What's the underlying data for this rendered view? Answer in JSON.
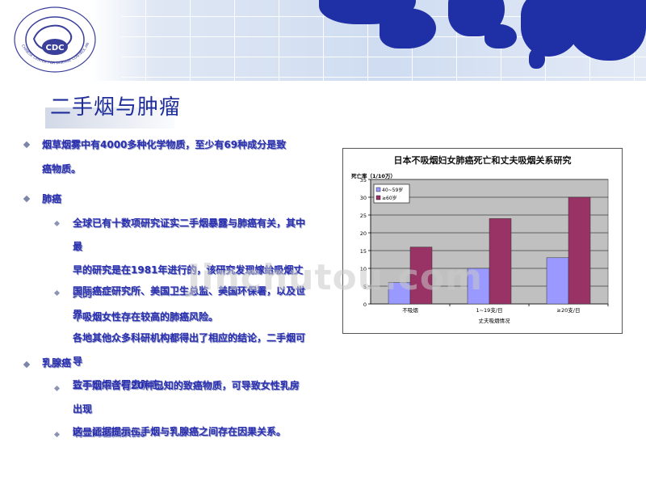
{
  "header": {
    "logo_text": "CDC",
    "logo_ring_text": "CHINESE CENTER FOR DISEASE CONTROL AND PREVENTION"
  },
  "title": "二手烟与肿瘤",
  "bullets": [
    {
      "id": "b1",
      "text": "烟草烟雾中有4000多种化学物质，至少有69种成分是致",
      "cont": "癌物质。"
    },
    {
      "id": "b2",
      "text": "肺癌"
    },
    {
      "id": "b3",
      "lines": [
        "全球已有十数项研究证实二手烟暴露与肺癌有关，其中最",
        "早的研究是在1981年进行的，该研究发现嫁给吸烟丈夫的",
        "不吸烟女性存在较高的肺癌风险。"
      ]
    },
    {
      "id": "b4",
      "lines": [
        "国际癌症研究所、美国卫生总监、美国环保署，以及世界",
        "各地其他众多科研机构都得出了相应的结论，二手烟可导",
        "致不吸烟者罹患肺癌。"
      ]
    },
    {
      "id": "b5",
      "text": "乳腺癌"
    },
    {
      "id": "b6",
      "lines": [
        "二手烟中含有20种已知的致癌物质，可导致女性乳房出现",
        "明显的基因损伤。"
      ]
    },
    {
      "id": "b7",
      "lines": [
        "这一证据提示二手烟与乳腺癌之间存在因果关系。"
      ]
    }
  ],
  "watermark": "Jinchutou.com",
  "chart_data": {
    "type": "bar",
    "title": "日本不吸烟妇女肺癌死亡和丈夫吸烟关系研究",
    "ylabel": "死亡率（1/10万）",
    "xlabel": "丈夫吸烟情况",
    "categories": [
      "不吸烟",
      "1~19支/日",
      "≥20支/日"
    ],
    "series": [
      {
        "name": "40~59岁",
        "values": [
          6,
          10,
          13
        ],
        "color": "#9999ff"
      },
      {
        "name": "≥60岁",
        "values": [
          16,
          24,
          30
        ],
        "color": "#993366"
      }
    ],
    "ylim": [
      0,
      35
    ],
    "yticks": [
      0,
      5,
      10,
      15,
      20,
      25,
      30,
      35
    ],
    "grid": true,
    "legend": "top-left",
    "plot_background": "#c0c0c0"
  }
}
